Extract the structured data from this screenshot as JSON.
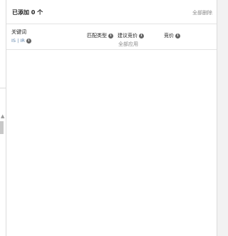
{
  "header": {
    "added_count": "已添加 0 个",
    "remove_all": "全部删除"
  },
  "columns": {
    "keyword": {
      "label": "关键词",
      "sub_label": "IS | IR"
    },
    "match_type": {
      "label": "匹配类型"
    },
    "suggested_bid": {
      "label": "建议竞价",
      "apply_all": "全部应用"
    },
    "bid": {
      "label": "竞价"
    }
  },
  "icons": {
    "info": "info-icon",
    "scroll_up": "chevron-up-icon"
  }
}
